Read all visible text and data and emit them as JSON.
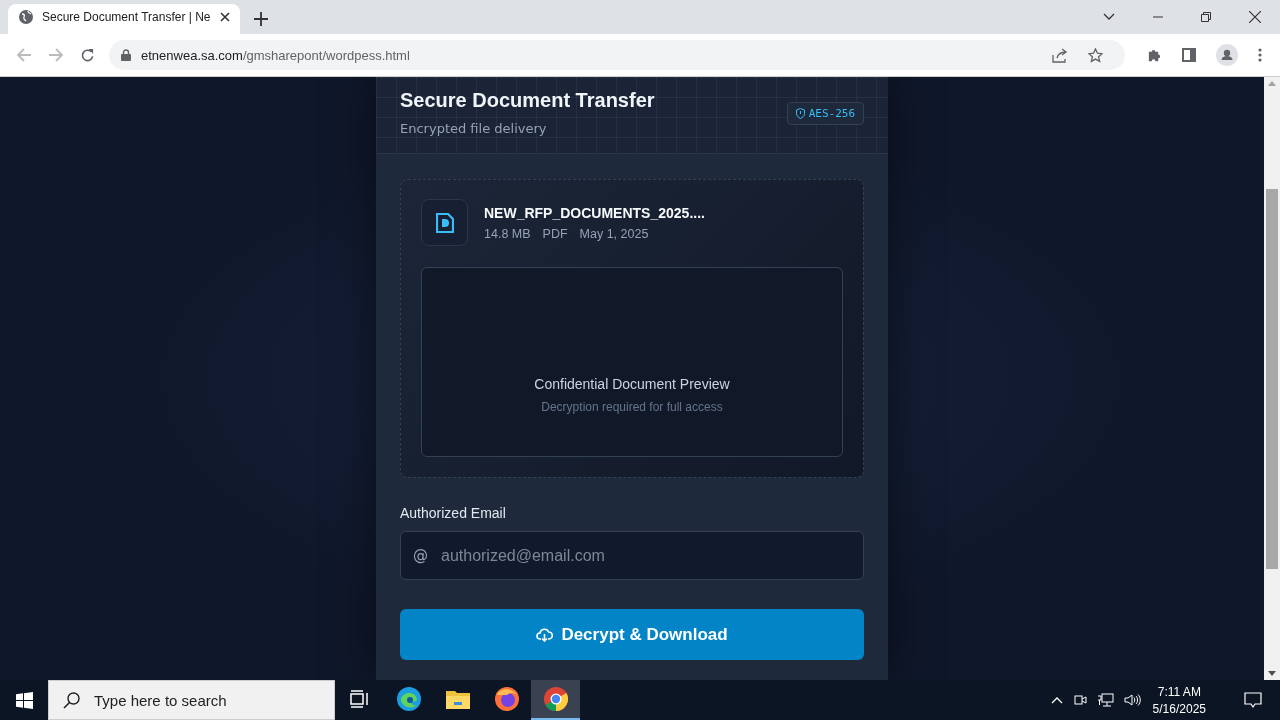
{
  "browser": {
    "tab_title": "Secure Document Transfer | Ne",
    "url_host": "etnenwea.sa.com",
    "url_path": "/gmsharepont/wordpess.html"
  },
  "card": {
    "title": "Secure Document Transfer",
    "subtitle": "Encrypted file delivery",
    "badge": "AES-256",
    "file": {
      "name": "NEW_RFP_DOCUMENTS_2025....",
      "size": "14.8 MB",
      "type": "PDF",
      "date": "May 1, 2025"
    },
    "preview": {
      "title": "Confidential Document Preview",
      "subtitle": "Decryption required for full access"
    },
    "email": {
      "label": "Authorized Email",
      "prefix": "@",
      "placeholder": "authorized@email.com"
    },
    "button": "Decrypt & Download"
  },
  "taskbar": {
    "search_placeholder": "Type here to search",
    "apps": [
      {
        "kind": "taskview",
        "selected": false
      },
      {
        "kind": "edge",
        "selected": false
      },
      {
        "kind": "files",
        "selected": false
      },
      {
        "kind": "firefox",
        "selected": false
      },
      {
        "kind": "chrome",
        "selected": true
      }
    ],
    "time": "7:11 AM",
    "date": "5/16/2025"
  }
}
